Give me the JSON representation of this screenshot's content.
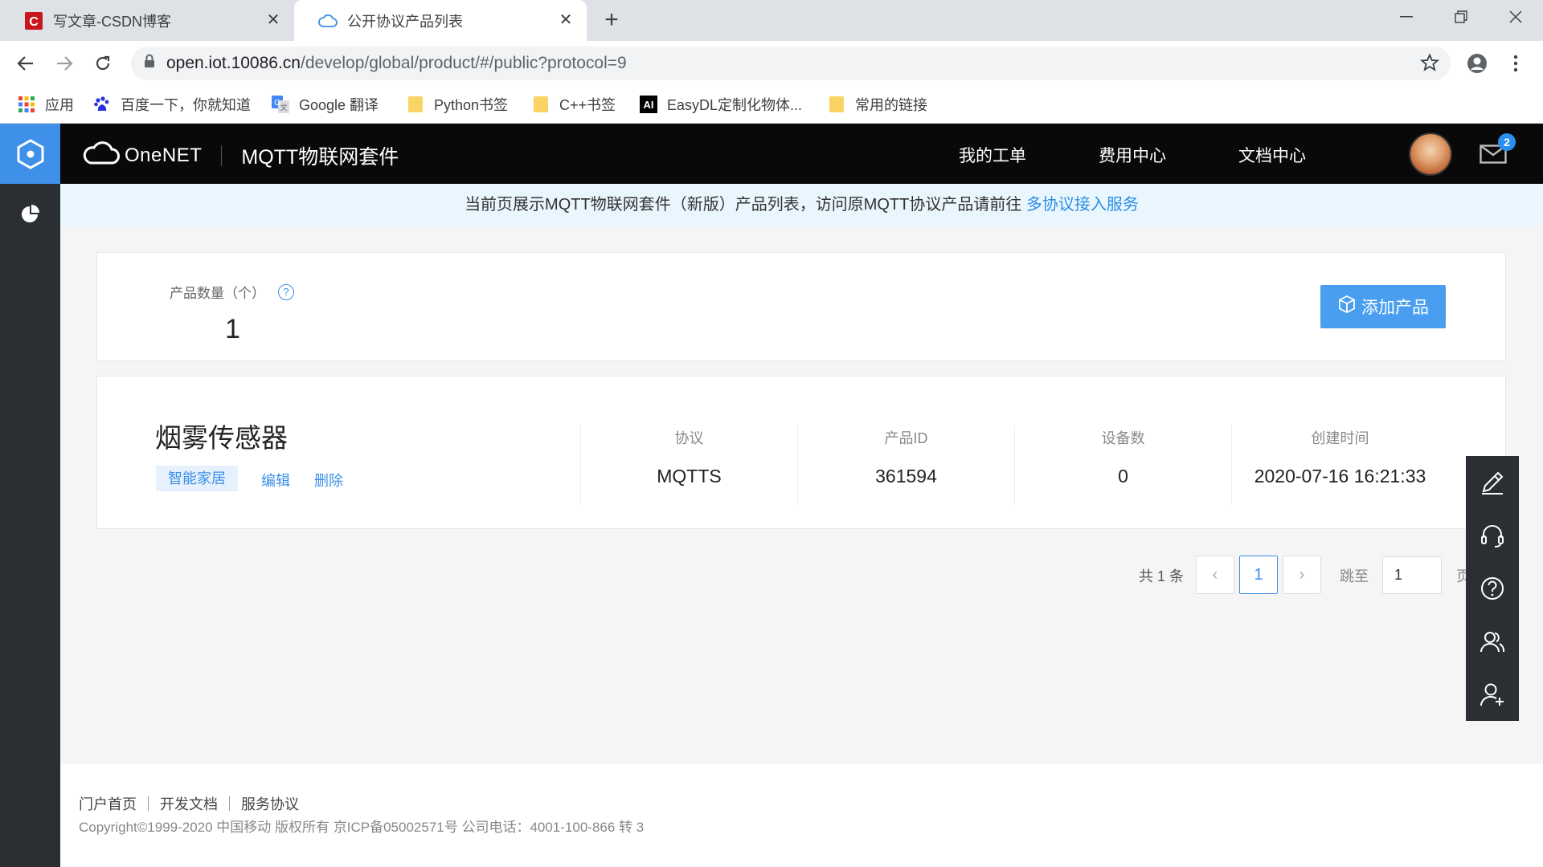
{
  "browser": {
    "tabs": [
      {
        "title": "写文章-CSDN博客",
        "favicon": "csdn-logo"
      },
      {
        "title": "公开协议产品列表",
        "favicon": "cloud-icon",
        "active": true
      }
    ],
    "url_host": "open.iot.10086.cn",
    "url_path": "/develop/global/product/#/public?protocol=9",
    "bookmarks": [
      {
        "label": "应用",
        "icon": "apps-grid-icon"
      },
      {
        "label": "百度一下，你就知道",
        "icon": "baidu-paw-icon"
      },
      {
        "label": "Google 翻译",
        "icon": "google-translate-icon"
      },
      {
        "label": "Python书签",
        "icon": "folder-icon"
      },
      {
        "label": "C++书签",
        "icon": "folder-icon"
      },
      {
        "label": "EasyDL定制化物体...",
        "icon": "ai-logo"
      },
      {
        "label": "常用的链接",
        "icon": "folder-icon"
      }
    ]
  },
  "header": {
    "brand": "OneNET",
    "suite": "MQTT物联网套件",
    "nav": [
      "我的工单",
      "费用中心",
      "文档中心"
    ],
    "mail_badge": "2"
  },
  "notice": {
    "text": "当前页展示MQTT物联网套件（新版）产品列表，访问原MQTT协议产品请前往 ",
    "link": "多协议接入服务"
  },
  "summary": {
    "count_label": "产品数量（个）",
    "count_value": "1",
    "add_button": "添加产品"
  },
  "product": {
    "name": "烟雾传感器",
    "tag": "智能家居",
    "actions": [
      "编辑",
      "删除"
    ],
    "columns": [
      {
        "header": "协议",
        "value": "MQTTS"
      },
      {
        "header": "产品ID",
        "value": "361594"
      },
      {
        "header": "设备数",
        "value": "0"
      },
      {
        "header": "创建时间",
        "value": "2020-07-16 16:21:33"
      }
    ]
  },
  "pagination": {
    "total": "共 1 条",
    "current": "1",
    "jump_label": "跳至",
    "jump_value": "1",
    "unit": "页"
  },
  "footer": {
    "links": [
      "门户首页",
      "开发文档",
      "服务协议"
    ],
    "copyright": "Copyright©1999-2020 中国移动 版权所有 京ICP备05002571号 公司电话：4001-100-866 转 3"
  },
  "colors": {
    "accent": "#3b8fe8",
    "topnav": "#090909",
    "sidebar": "#2b2e33",
    "notice_bg": "#eaf6fd"
  }
}
